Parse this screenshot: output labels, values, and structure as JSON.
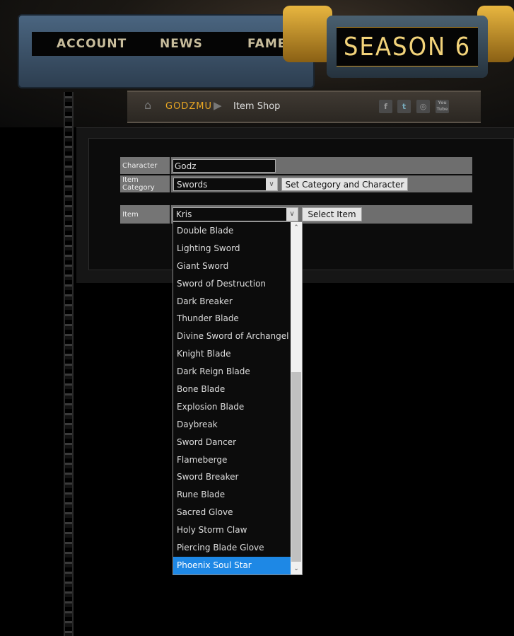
{
  "nav": {
    "items": [
      "ACCOUNT",
      "NEWS",
      "FAME"
    ],
    "logo": "SEASON 6"
  },
  "breadcrumb": {
    "home": "GODZMU",
    "current": "Item Shop"
  },
  "social": [
    "f",
    "t",
    "◎",
    "You Tube"
  ],
  "form": {
    "character_label": "Character",
    "character_value": "Godz",
    "category_label": "Item Category",
    "category_value": "Swords",
    "set_button": "Set Category and Character",
    "item_label": "Item",
    "item_value": "Kris",
    "select_button": "Select Item"
  },
  "dropdown": {
    "options": [
      "Double Blade",
      "Lighting Sword",
      "Giant Sword",
      "Sword of Destruction",
      "Dark Breaker",
      "Thunder Blade",
      "Divine Sword of Archangel",
      "Knight Blade",
      "Dark Reign Blade",
      "Bone Blade",
      "Explosion Blade",
      "Daybreak",
      "Sword Dancer",
      "Flameberge",
      "Sword Breaker",
      "Rune Blade",
      "Sacred Glove",
      "Holy Storm Claw",
      "Piercing Blade Glove",
      "Phoenix Soul Star"
    ],
    "highlighted": "Phoenix Soul Star"
  },
  "colors": {
    "accent": "#e8a623",
    "highlight": "#1e88e5"
  }
}
